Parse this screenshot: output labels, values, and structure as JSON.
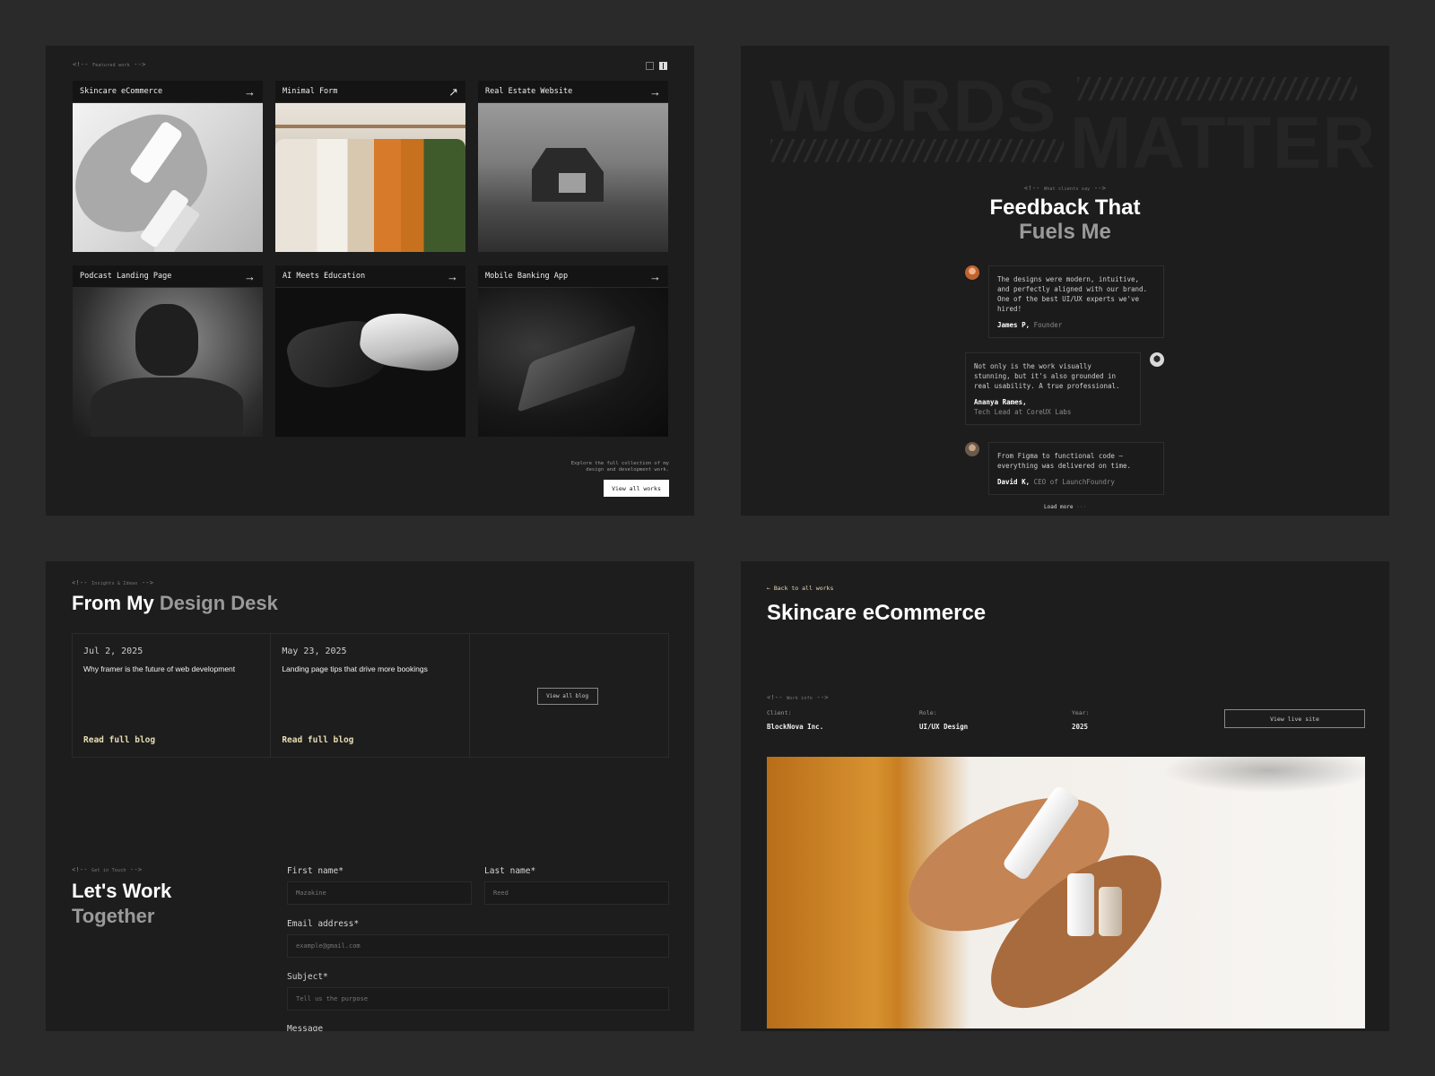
{
  "featured": {
    "comment_open": "<!--",
    "comment_label": "Featured work",
    "comment_close": "-->",
    "works": [
      {
        "title": "Skincare eCommerce",
        "arrow": "→"
      },
      {
        "title": "Minimal Form",
        "arrow": "↗"
      },
      {
        "title": "Real Estate Website",
        "arrow": "→"
      },
      {
        "title": "Podcast Landing Page",
        "arrow": "→"
      },
      {
        "title": "AI Meets Education",
        "arrow": "→"
      },
      {
        "title": "Mobile Banking App",
        "arrow": "→"
      }
    ],
    "explore_text": "Explore the full collection of my design and development work.",
    "view_all_label": "View all works"
  },
  "testimonials": {
    "big_word_1": "WORDS",
    "big_word_2": "MATTER",
    "comment_open": "<!--",
    "comment_label": "What clients say",
    "comment_close": "-->",
    "title_line1": "Feedback That",
    "title_line2": "Fuels Me",
    "items": [
      {
        "quote": "The designs were modern, intuitive, and perfectly aligned with our brand. One of the best UI/UX experts we've hired!",
        "name": "James P,",
        "role": "Founder"
      },
      {
        "quote": "Not only is the work visually stunning, but it's also grounded in real usability. A true professional.",
        "name": "Ananya Rames,",
        "role": "Tech Lead at CoreUX Labs"
      },
      {
        "quote": "From Figma to functional code — everything was delivered on time.",
        "name": "David K,",
        "role": "CEO of LaunchFoundry"
      }
    ],
    "load_more_label": "Load more",
    "load_more_dots": "···"
  },
  "blog": {
    "comment_open": "<!--",
    "comment_label": "Insights & Ideas",
    "comment_close": "-->",
    "title_main": "From My",
    "title_highlight": "Design Desk",
    "posts": [
      {
        "date": "Jul 2, 2025",
        "headline": "Why framer is the future of web development",
        "link": "Read full blog"
      },
      {
        "date": "May 23, 2025",
        "headline": "Landing page tips that drive more bookings",
        "link": "Read full blog"
      }
    ],
    "view_all_label": "View all blog"
  },
  "contact": {
    "comment_open": "<!--",
    "comment_label": "Get in Touch",
    "comment_close": "-->",
    "title_line1": "Let's Work",
    "title_line2": "Together",
    "first_name_label": "First name*",
    "first_name_placeholder": "Mazakine",
    "last_name_label": "Last name*",
    "last_name_placeholder": "Reed",
    "email_label": "Email address*",
    "email_placeholder": "example@gmail.com",
    "subject_label": "Subject*",
    "subject_placeholder": "Tell us the purpose",
    "message_label": "Message"
  },
  "case_study": {
    "back_label": "← Back to all works",
    "title": "Skincare eCommerce",
    "comment_open": "<!--",
    "comment_label": "Work info",
    "comment_close": "-->",
    "client_label": "Client:",
    "client_value": "BlockNova Inc.",
    "role_label": "Role:",
    "role_value": "UI/UX Design",
    "year_label": "Year:",
    "year_value": "2025",
    "live_site_label": "View live site"
  },
  "colors": {
    "background": "#2a2a2a",
    "panel": "#1d1d1d",
    "accent": "#e8dcb4",
    "muted_text": "#9a9a9a"
  }
}
